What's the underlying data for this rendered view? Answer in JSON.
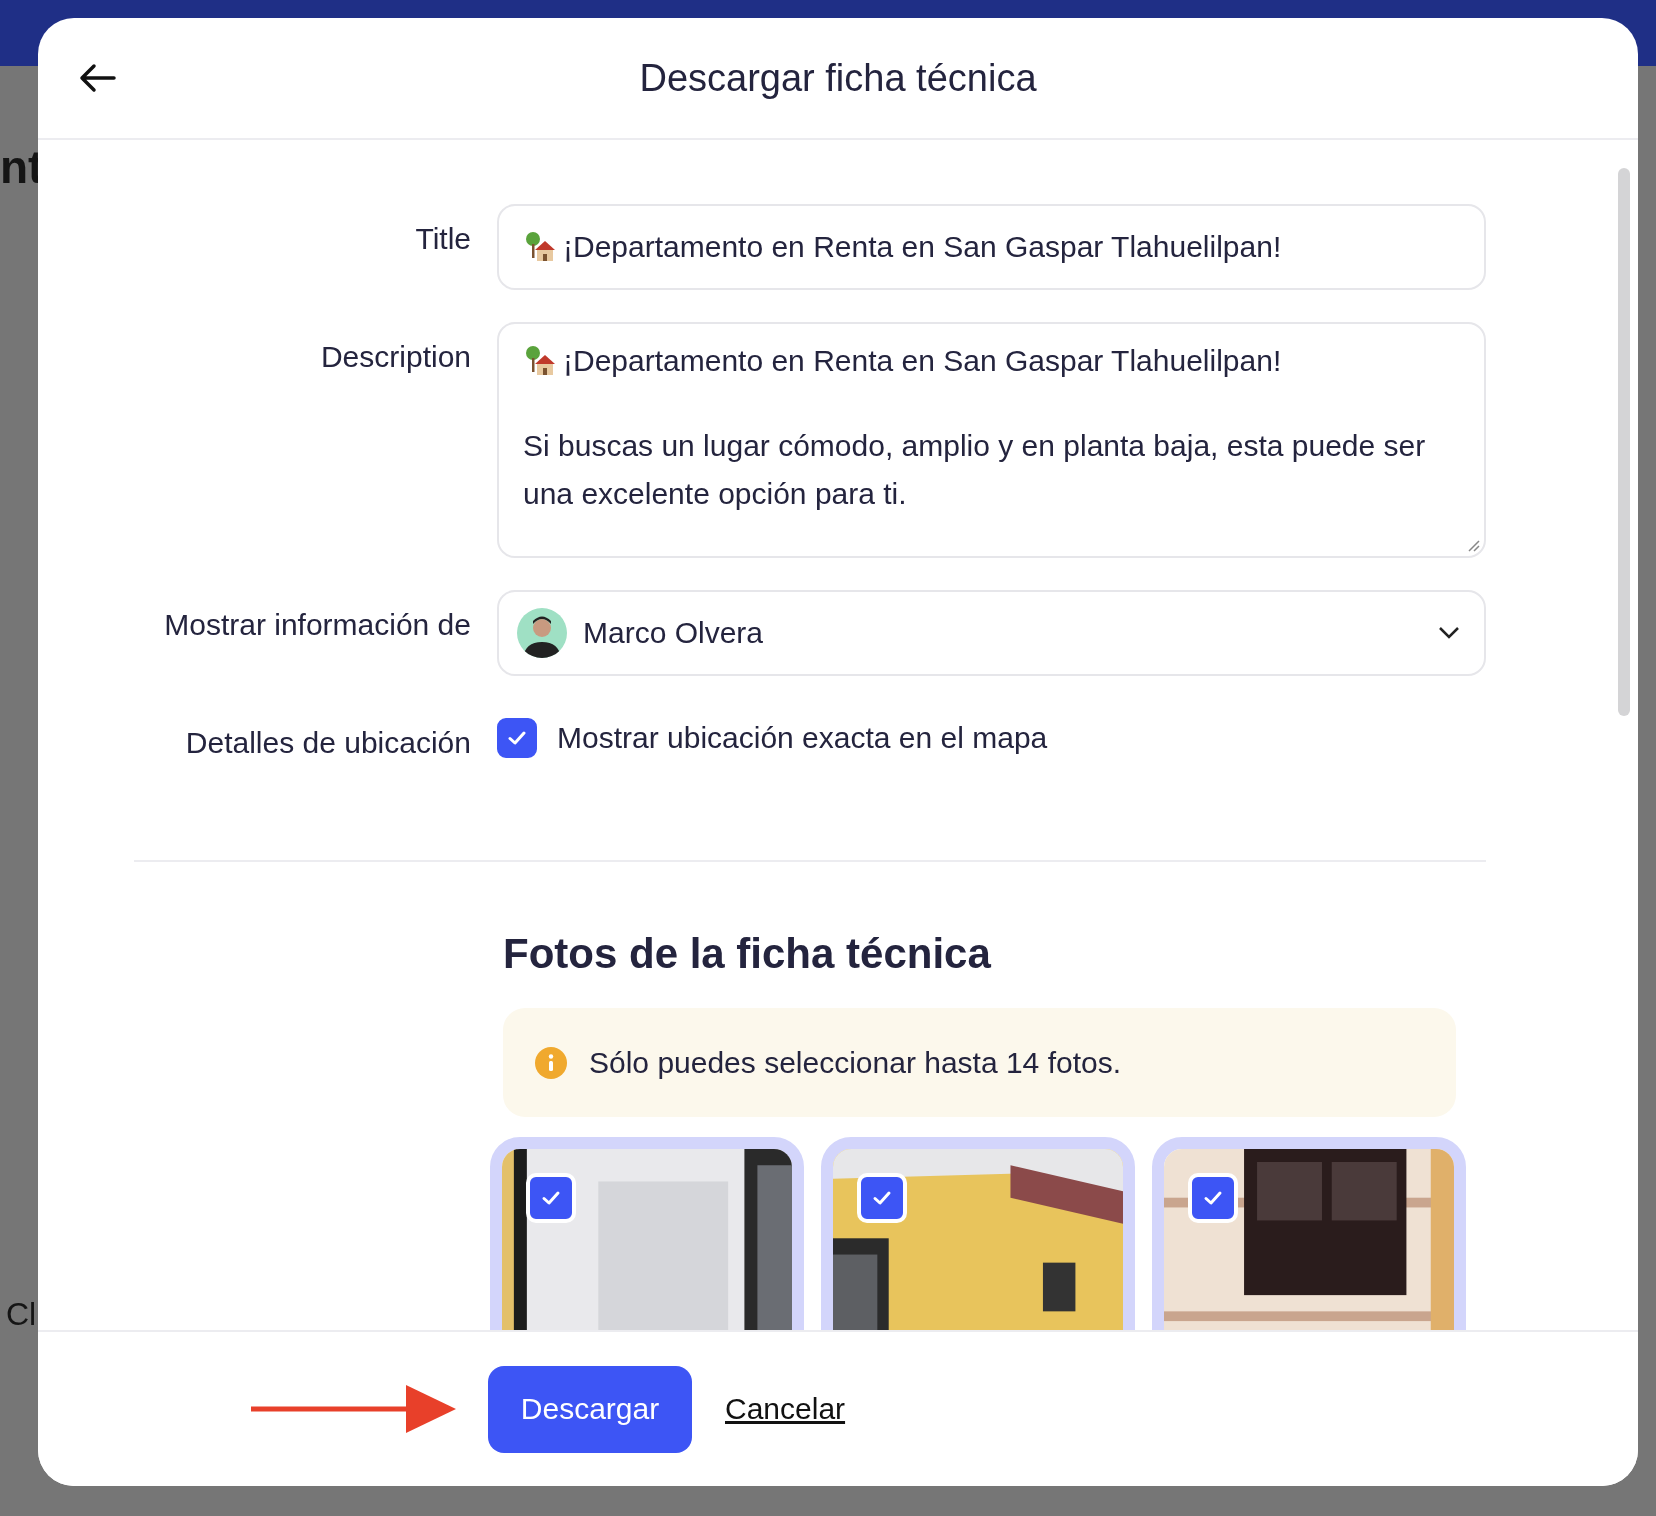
{
  "background": {
    "fragments": [
      "nt",
      "Cl"
    ]
  },
  "dialog": {
    "title": "Descargar ficha técnica",
    "fields": [
      {
        "kind": "text",
        "label": "Title",
        "value": "¡Departamento en Renta en San Gaspar Tlahuelilpan!"
      },
      {
        "kind": "textarea",
        "label": "Description",
        "lines": [
          "¡Departamento en Renta en San Gaspar Tlahuelilpan!",
          "Si buscas un lugar cómodo, amplio y en planta baja, esta puede ser una excelente opción para ti."
        ]
      },
      {
        "kind": "select",
        "label": "Mostrar información de",
        "value": "Marco Olvera"
      },
      {
        "kind": "checkbox",
        "label": "Detalles de ubicación",
        "text": "Mostrar ubicación exacta en el mapa",
        "checked": true
      }
    ],
    "photos_heading": "Fotos de la ficha técnica",
    "notice": "Sólo puedes seleccionar hasta 14 fotos.",
    "photos": [
      {
        "kind": "picture",
        "checked": true
      },
      {
        "kind": "picture",
        "checked": true
      },
      {
        "kind": "picture",
        "checked": true
      }
    ],
    "buttons": {
      "primary": "Descargar",
      "secondary": "Cancelar"
    }
  }
}
